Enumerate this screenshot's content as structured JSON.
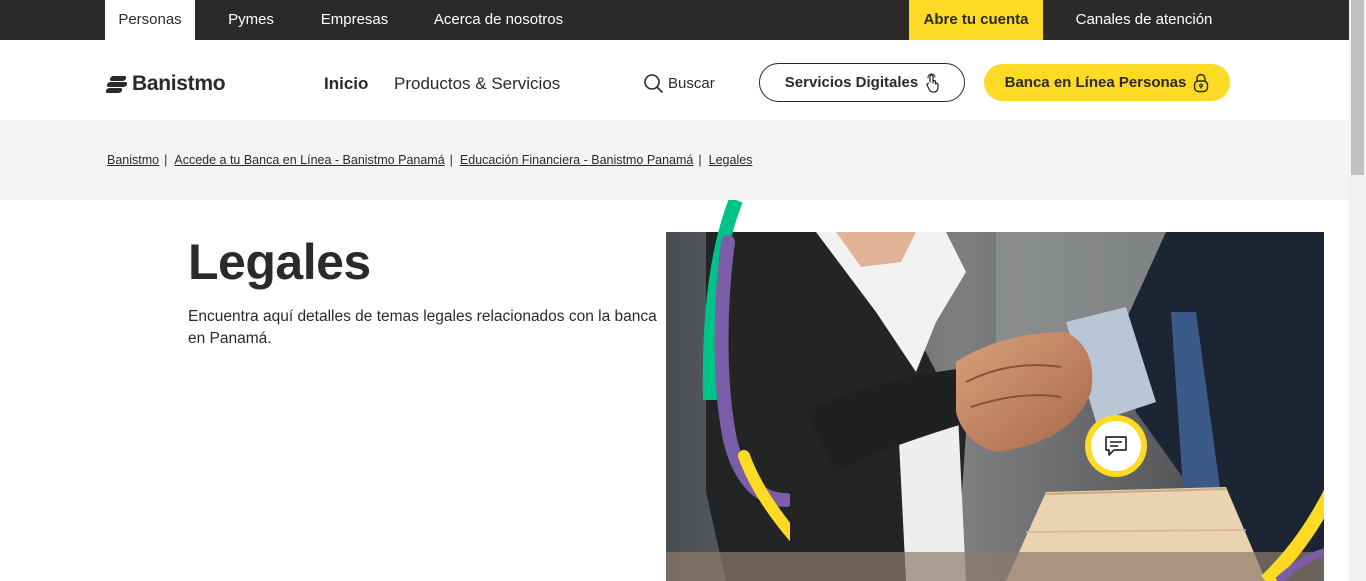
{
  "topbar": {
    "tabs": [
      "Personas",
      "Pymes",
      "Empresas",
      "Acerca de nosotros"
    ],
    "open_account": "Abre tu cuenta",
    "channels": "Canales de atención"
  },
  "header": {
    "logo": "Banistmo",
    "nav": [
      "Inicio",
      "Productos & Servicios"
    ],
    "search_label": "Buscar",
    "digital_services": "Servicios Digitales",
    "online_banking": "Banca en Línea Personas"
  },
  "breadcrumb": [
    "Banistmo",
    "Accede a tu Banca en Línea - Banistmo Panamá",
    "Educación Financiera - Banistmo Panamá",
    "Legales"
  ],
  "main": {
    "title": "Legales",
    "description": "Encuentra aquí detalles de temas legales relacionados con la banca en Panamá."
  },
  "colors": {
    "brand_yellow": "#fdda24",
    "dark": "#2c2a29",
    "accent_green": "#00c389",
    "accent_purple": "#7b5ea7"
  },
  "icons": {
    "search": "search-icon",
    "touch": "touch-icon",
    "lock": "lock-icon",
    "chat": "chat-icon"
  }
}
